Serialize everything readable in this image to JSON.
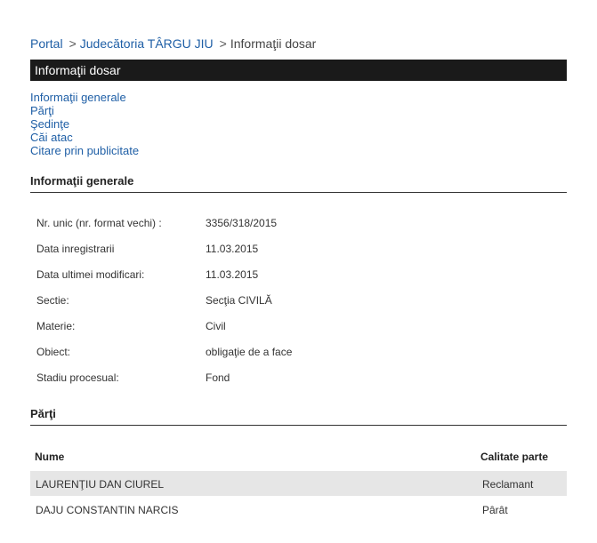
{
  "breadcrumb": {
    "portal": "Portal",
    "court": "Judecătoria TÂRGU JIU",
    "current": "Informaţii dosar",
    "separator": ">"
  },
  "title_bar": "Informaţii dosar",
  "nav_links": [
    "Informaţii generale",
    "Părţi",
    "Şedinţe",
    "Căi atac",
    "Citare prin publicitate"
  ],
  "general_info": {
    "heading": "Informaţii generale",
    "rows": [
      {
        "label": "Nr. unic (nr. format vechi) :",
        "value": "3356/318/2015"
      },
      {
        "label": "Data inregistrarii",
        "value": "11.03.2015"
      },
      {
        "label": "Data ultimei modificari:",
        "value": "11.03.2015"
      },
      {
        "label": "Sectie:",
        "value": "Secţia CIVILĂ"
      },
      {
        "label": "Materie:",
        "value": "Civil"
      },
      {
        "label": "Obiect:",
        "value": "obligaţie de a face"
      },
      {
        "label": "Stadiu procesual:",
        "value": "Fond"
      }
    ]
  },
  "parties": {
    "heading": "Părţi",
    "columns": [
      "Nume",
      "Calitate parte"
    ],
    "rows": [
      {
        "name": "LAURENŢIU DAN CIUREL",
        "role": "Reclamant"
      },
      {
        "name": "DAJU CONSTANTIN NARCIS",
        "role": "Pârât"
      }
    ]
  },
  "colors": {
    "link": "#1f5fa6",
    "title_bar": "#1a1a1a",
    "row_shade": "#e6e6e6"
  }
}
